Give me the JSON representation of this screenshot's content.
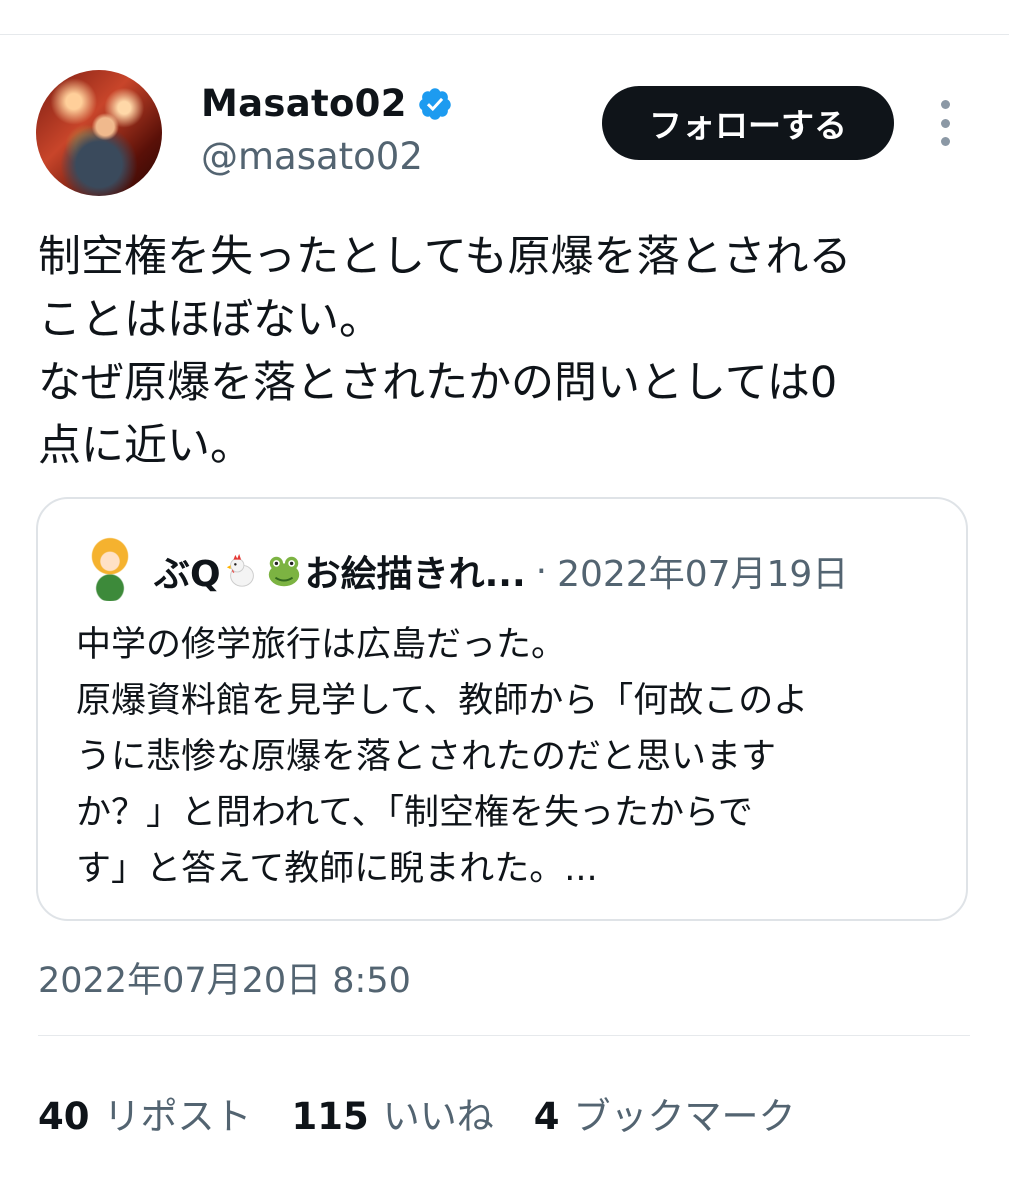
{
  "author": {
    "display_name": "Masato02",
    "handle": "@masato02",
    "verified_color": "#1d9bf0"
  },
  "actions": {
    "follow_label": "フォローする"
  },
  "tweet": {
    "text": "制空権を失ったとしても原爆を落とされる\nことはほぼない。\nなぜ原爆を落とされたかの問いとしては0\n点に近い。",
    "timestamp": "2022年07月20日 8:50"
  },
  "quote": {
    "name_part1": "ぶQ",
    "name_part2": "お絵描きれ...",
    "emojis": [
      "chicken-icon",
      "frog-icon"
    ],
    "separator": "·",
    "date": "2022年07月19日",
    "text": "中学の修学旅行は広島だった。\n原爆資料館を見学して、教師から「何故このよ\nうに悲惨な原爆を落とされたのだと思います\nか？」と問われて、「制空権を失ったからで\nす」と答えて教師に睨まれた。..."
  },
  "stats": {
    "reposts_count": "40",
    "reposts_label": "リポスト",
    "likes_count": "115",
    "likes_label": "いいね",
    "bookmarks_count": "4",
    "bookmarks_label": "ブックマーク"
  }
}
